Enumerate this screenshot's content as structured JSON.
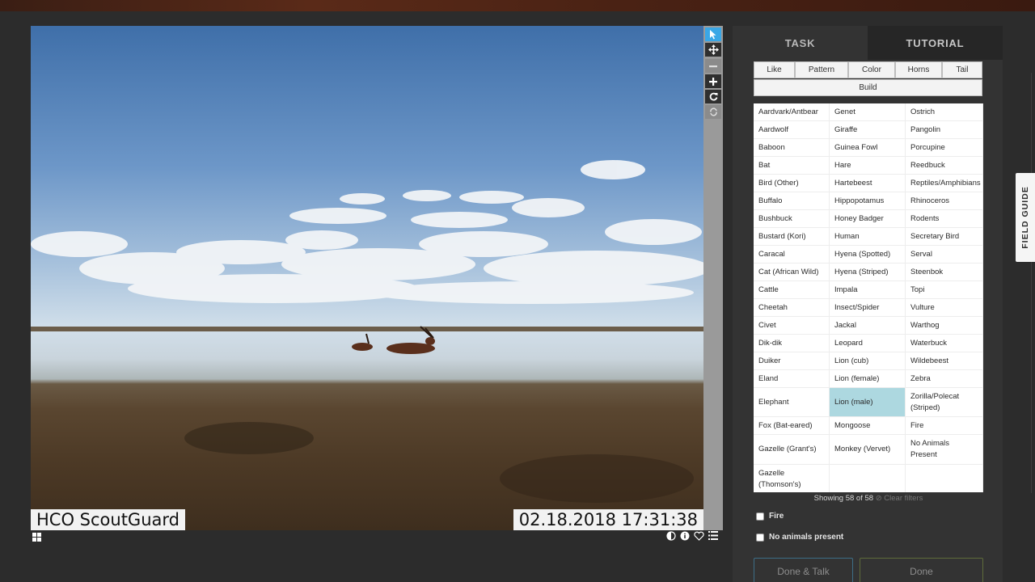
{
  "subject": {
    "caption_left": "HCO ScoutGuard",
    "caption_right": "02.18.2018 17:31:38"
  },
  "toolbar": {
    "icons": [
      "pointer-icon",
      "move-icon",
      "zoom-out-icon",
      "zoom-in-icon",
      "rotate-icon",
      "reset-icon"
    ]
  },
  "meta_icons": [
    "grid-icon",
    "invert-icon",
    "info-icon",
    "favorite-icon",
    "collections-icon"
  ],
  "tabs": {
    "task": "TASK",
    "tutorial": "TUTORIAL"
  },
  "filters": {
    "like": "Like",
    "pattern": "Pattern",
    "color": "Color",
    "horns": "Horns",
    "tail": "Tail",
    "build": "Build"
  },
  "choices": {
    "col1": [
      "Aardvark/Antbear",
      "Aardwolf",
      "Baboon",
      "Bat",
      "Bird (Other)",
      "Buffalo",
      "Bushbuck",
      "Bustard (Kori)",
      "Caracal",
      "Cat (African Wild)",
      "Cattle",
      "Cheetah",
      "Civet",
      "Dik-dik",
      "Duiker",
      "Eland",
      "Elephant",
      "Fox (Bat-eared)",
      "Gazelle (Grant's)",
      "Gazelle (Thomson's)"
    ],
    "col2": [
      "Genet",
      "Giraffe",
      "Guinea Fowl",
      "Hare",
      "Hartebeest",
      "Hippopotamus",
      "Honey Badger",
      "Human",
      "Hyena (Spotted)",
      "Hyena (Striped)",
      "Impala",
      "Insect/Spider",
      "Jackal",
      "Leopard",
      "Lion (cub)",
      "Lion (female)",
      "Lion (male)",
      "Mongoose",
      "Monkey (Vervet)"
    ],
    "col3": [
      "Ostrich",
      "Pangolin",
      "Porcupine",
      "Reedbuck",
      "Reptiles/Amphibians",
      "Rhinoceros",
      "Rodents",
      "Secretary Bird",
      "Serval",
      "Steenbok",
      "Topi",
      "Vulture",
      "Warthog",
      "Waterbuck",
      "Wildebeest",
      "Zebra",
      "Zorilla/Polecat (Striped)",
      "Fire",
      "No Animals Present"
    ],
    "selected": "Lion (male)"
  },
  "status": {
    "showing": "Showing 58 of 58",
    "clear": "⊘ Clear filters"
  },
  "checkboxes": {
    "fire": "Fire",
    "no_animals": "No animals present"
  },
  "buttons": {
    "done_talk": "Done & Talk",
    "done": "Done"
  },
  "field_guide": "FIELD GUIDE"
}
